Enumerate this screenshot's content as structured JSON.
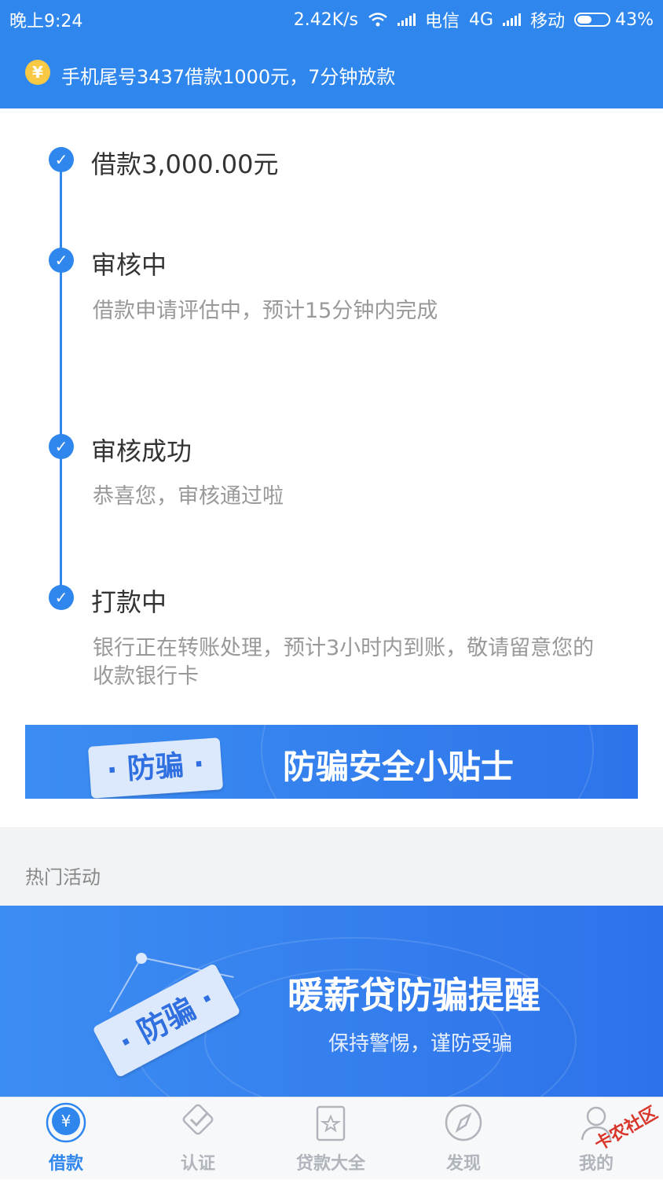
{
  "status_bar": {
    "time": "晚上9:24",
    "speed": "2.42K/s",
    "carrier1": "电信",
    "network": "4G",
    "carrier2": "移动",
    "battery": "43%"
  },
  "notice": {
    "icon": "yuan-coin-icon",
    "icon_text": "¥",
    "text": "手机尾号3437借款1000元，7分钟放款"
  },
  "timeline": {
    "steps": [
      {
        "title": "借款3,000.00元",
        "desc": ""
      },
      {
        "title": "审核中",
        "desc": "借款申请评估中，预计15分钟内完成"
      },
      {
        "title": "审核成功",
        "desc": "恭喜您，审核通过啦"
      },
      {
        "title": "打款中",
        "desc": "银行正在转账处理，预计3小时内到账，敬请留意您的收款银行卡"
      }
    ],
    "check_glyph": "✓"
  },
  "banner_tips": {
    "tag": "· 防骗 ·",
    "title": "防骗安全小贴士"
  },
  "hot_section": {
    "label": "热门活动"
  },
  "banner_activity": {
    "tag": "· 防骗 ·",
    "title": "暖薪贷防骗提醒",
    "subtitle": "保持警惕，谨防受骗"
  },
  "tabbar": {
    "items": [
      {
        "label": "借款",
        "icon": "yuan-icon",
        "active": true
      },
      {
        "label": "认证",
        "icon": "check-badge-icon",
        "active": false
      },
      {
        "label": "贷款大全",
        "icon": "star-book-icon",
        "active": false
      },
      {
        "label": "发现",
        "icon": "compass-icon",
        "active": false
      },
      {
        "label": "我的",
        "icon": "user-icon",
        "active": false
      }
    ]
  },
  "watermark": "卡农社区",
  "colors": {
    "primary": "#2f87ee",
    "inactive_tab": "#b0b4bb"
  }
}
